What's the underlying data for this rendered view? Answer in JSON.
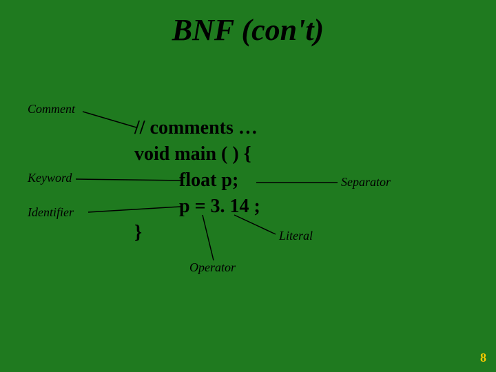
{
  "title": "BNF (con't)",
  "labels": {
    "comment": "Comment",
    "keyword": "Keyword",
    "identifier": "Identifier",
    "separator": "Separator",
    "literal": "Literal",
    "operator": "Operator"
  },
  "code": {
    "line1": "// comments …",
    "line2": "void main ( ) {",
    "line3": "float p;",
    "line4": "p = 3. 14 ;",
    "line5": "}"
  },
  "pagenum": "8"
}
